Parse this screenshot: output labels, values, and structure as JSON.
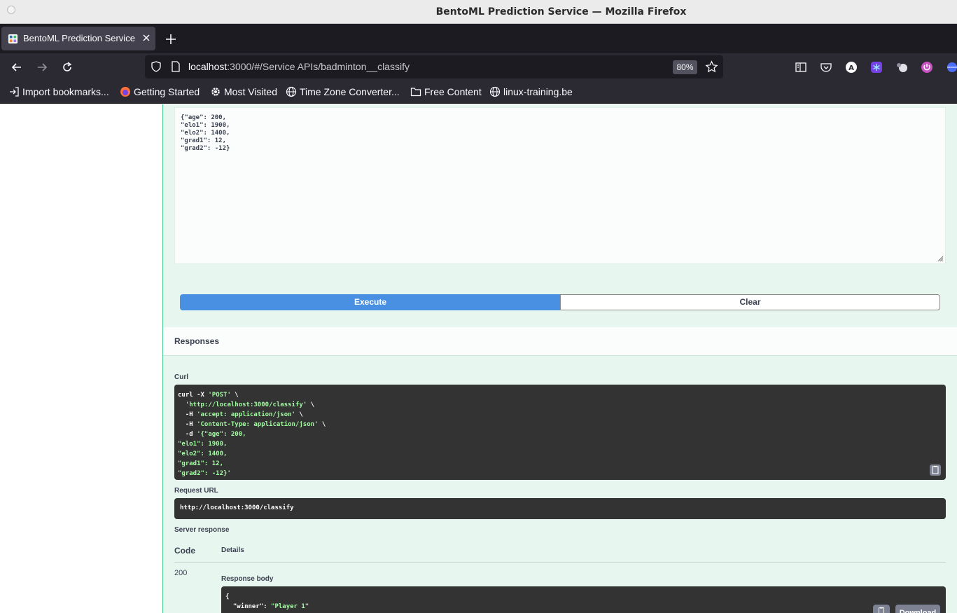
{
  "window": {
    "title": "BentoML Prediction Service — Mozilla Firefox"
  },
  "tab": {
    "title": "BentoML Prediction Service",
    "favicon": "bentoml-icon"
  },
  "nav": {
    "url_host": "localhost",
    "url_rest": ":3000/#/Service APIs/badminton__classify",
    "zoom": "80%"
  },
  "bookmarks": [
    {
      "label": "Import bookmarks...",
      "icon": "import-icon"
    },
    {
      "label": "Getting Started",
      "icon": "firefox-icon"
    },
    {
      "label": "Most Visited",
      "icon": "gear-icon"
    },
    {
      "label": "Time Zone Converter...",
      "icon": "globe-icon"
    },
    {
      "label": "Free Content",
      "icon": "folder-icon"
    },
    {
      "label": "linux-training.be",
      "icon": "globe-icon"
    }
  ],
  "request_body": "{\"age\": 200,\n\"elo1\": 1900,\n\"elo2\": 1400,\n\"grad1\": 12,\n\"grad2\": -12}",
  "buttons": {
    "execute": "Execute",
    "clear": "Clear"
  },
  "responses": {
    "title": "Responses",
    "curl_label": "Curl",
    "curl": {
      "line1_cmd": "curl -X ",
      "line1_str": "'POST'",
      "line1_tail": " \\",
      "line2_str": "'http://localhost:3000/classify'",
      "line3_flag": "  -H ",
      "line3_str": "'accept: application/json'",
      "line4_flag": "  -H ",
      "line4_str": "'Content-Type: application/json'",
      "line5_flag": "  -d ",
      "line5_str": "'{\"age\": 200,",
      "line6": "\"elo1\": 1900,",
      "line7": "\"elo2\": 1400,",
      "line8": "\"grad1\": 12,",
      "line9": "\"grad2\": -12}'"
    },
    "request_url_label": "Request URL",
    "request_url": "http://localhost:3000/classify",
    "server_response_label": "Server response",
    "code_header": "Code",
    "details_header": "Details",
    "code": "200",
    "response_body_label": "Response body",
    "response_body_open": "{",
    "response_key": "  \"winner\": ",
    "response_value": "\"Player 1\"",
    "download_label": "Download"
  },
  "colors": {
    "execute": "#4990e2",
    "post_bg": "#e8f6f0",
    "post_border": "#49cc90",
    "code_bg": "#333333",
    "code_string": "#a2fca2"
  }
}
